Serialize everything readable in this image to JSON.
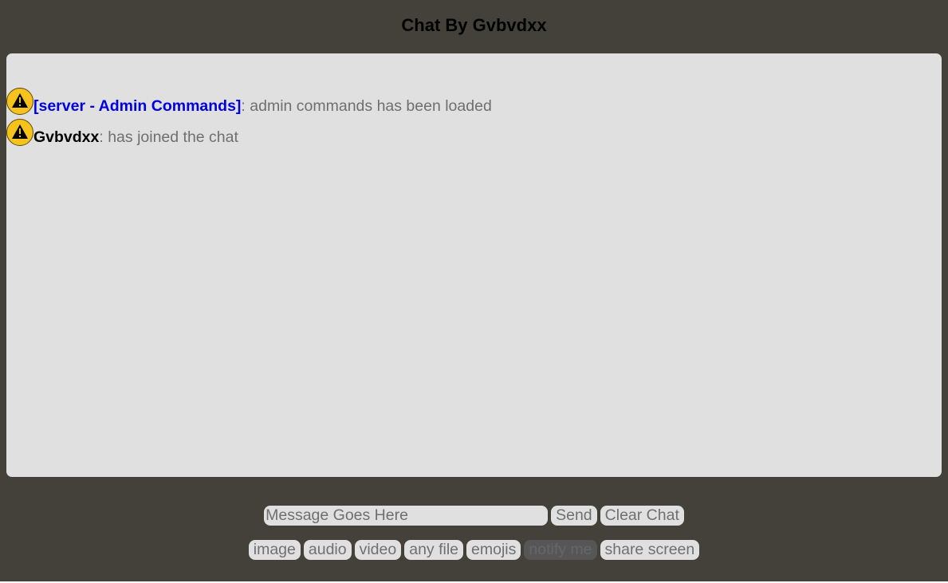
{
  "header": {
    "title": "Chat By Gvbvdxx"
  },
  "messages": [
    {
      "sender": "[server - Admin Commands]",
      "sender_color": "#0000e0",
      "text": ": admin commands has been loaded"
    },
    {
      "sender": "Gvbvdxx",
      "sender_color": "#000000",
      "text": ": has joined the chat"
    }
  ],
  "composer": {
    "placeholder": "Message Goes Here",
    "send_label": "Send",
    "clear_label": "Clear Chat"
  },
  "toolbar": {
    "image_label": "image",
    "audio_label": "audio",
    "video_label": "video",
    "any_file_label": "any file",
    "emojis_label": "emojis",
    "notify_label": "notify me",
    "share_screen_label": "share screen"
  },
  "colors": {
    "background": "#43413a",
    "panel": "#e0e0e0",
    "avatar": "#f6c21c",
    "server_sender": "#0000e0"
  }
}
